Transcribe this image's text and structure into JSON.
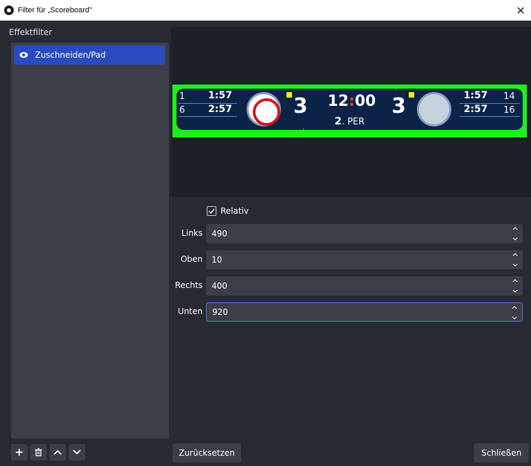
{
  "window": {
    "title": "Filter für „Scoreboard\""
  },
  "left_panel": {
    "header": "Effektfilter",
    "filters": [
      {
        "label": "Zuschneiden/Pad",
        "visible": true
      }
    ]
  },
  "scoreboard": {
    "left": {
      "pen_numbers": [
        "1",
        "6"
      ],
      "pen_times": [
        "1:57",
        "2:57"
      ],
      "score": "3"
    },
    "center": {
      "clock_left": "12",
      "clock_sep": ":",
      "clock_right": "00",
      "period_num": "2",
      "period_label": ". PER"
    },
    "right": {
      "score": "3",
      "pen_times": [
        "1:57",
        "2:57"
      ],
      "pen_numbers": [
        "14",
        "16"
      ]
    },
    "colors": {
      "key_green": "#1cf01c",
      "panel_navy": "#0b2346",
      "penalty_yellow": "#ffeb00"
    }
  },
  "form": {
    "relative": {
      "label": "Relativ",
      "checked": true
    },
    "fields": [
      {
        "label": "Links",
        "value": "490"
      },
      {
        "label": "Oben",
        "value": "10"
      },
      {
        "label": "Rechts",
        "value": "400"
      },
      {
        "label": "Unten",
        "value": "920"
      }
    ]
  },
  "buttons": {
    "reset": "Zurücksetzen",
    "close": "Schließen"
  },
  "toolbar_icons": [
    "add-icon",
    "trash-icon",
    "chevron-up-icon",
    "chevron-down-icon"
  ],
  "colors": {
    "accent": "#284bbf",
    "focus": "#4a7dff",
    "panel": "#3b3e47",
    "background": "#272a33"
  }
}
